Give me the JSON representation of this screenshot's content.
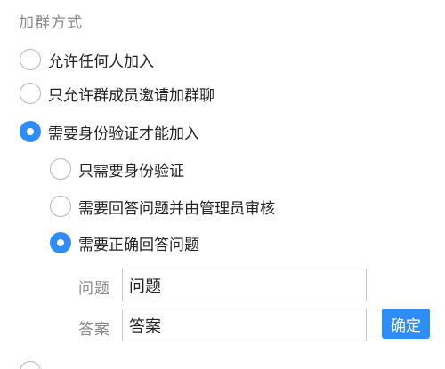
{
  "section": {
    "title": "加群方式"
  },
  "join_options": [
    {
      "label": "允许任何人加入",
      "checked": false
    },
    {
      "label": "只允许群成员邀请加群聊",
      "checked": false
    },
    {
      "label": "需要身份验证才能加入",
      "checked": true
    }
  ],
  "verification_options": [
    {
      "label": "只需要身份验证",
      "checked": false
    },
    {
      "label": "需要回答问题并由管理员审核",
      "checked": false
    },
    {
      "label": "需要正确回答问题",
      "checked": true
    }
  ],
  "question_field": {
    "label": "问题",
    "value": "问题"
  },
  "answer_field": {
    "label": "答案",
    "value": "答案"
  },
  "confirm_button": {
    "label": "确定"
  },
  "colors": {
    "accent": "#2f8df7",
    "muted_text": "#8a8a8a"
  }
}
